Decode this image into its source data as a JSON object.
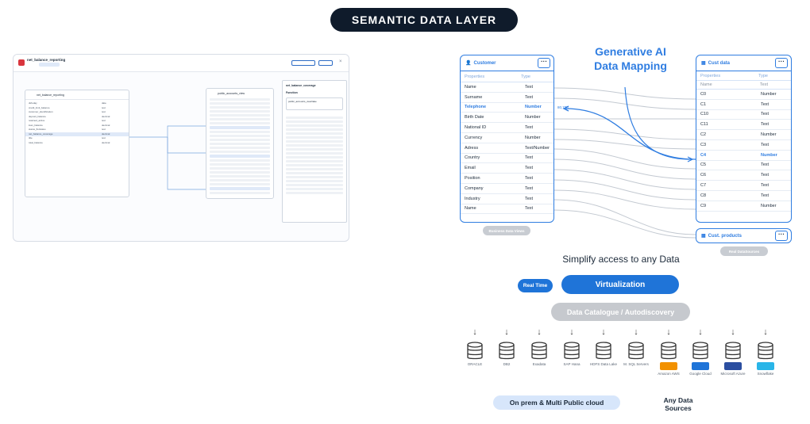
{
  "title": "SEMANTIC DATA LAYER",
  "left_app": {
    "title": "net_balance_reporting",
    "subtitle_a": "",
    "subtitle_b": "",
    "btn_a": "",
    "btn_b": "",
    "card_title": "net_balance_reporting",
    "rows": [
      {
        "k": "dt/today",
        "v": "date"
      },
      {
        "k": "credit_limit_balance",
        "v": "text"
      },
      {
        "k": "customer_identification",
        "v": "text"
      },
      {
        "k": "deposit_balance",
        "v": "decimal"
      },
      {
        "k": "retained_active",
        "v": "text"
      },
      {
        "k": "loan_balance",
        "v": "decimal"
      },
      {
        "k": "status_flo/status",
        "v": "text"
      },
      {
        "k": "net_balance_coverage",
        "v": "decimal"
      },
      {
        "k": "title",
        "v": "text"
      },
      {
        "k": "total_balance",
        "v": "decimal"
      }
    ],
    "mid_card_title": "public_accounts_view",
    "panel_title": "net_balance_coverage",
    "panel_field": "Function",
    "panel_value": "public_accounts_view/take",
    "panel_tabs": [
      "",
      "",
      ""
    ]
  },
  "generative": "Generative AI Data Mapping",
  "customer": {
    "title": "Customer",
    "col_props": "Properties",
    "col_type": "Type",
    "rows": [
      {
        "k": "Name",
        "v": "Text"
      },
      {
        "k": "Surname",
        "v": "Text"
      },
      {
        "k": "Telephone",
        "v": "Number"
      },
      {
        "k": "Birth Date",
        "v": "Number"
      },
      {
        "k": "National ID",
        "v": "Text"
      },
      {
        "k": "Currency",
        "v": "Number"
      },
      {
        "k": "Adress",
        "v": "Text/Number"
      },
      {
        "k": "Country",
        "v": "Text"
      },
      {
        "k": "Email",
        "v": "Text"
      },
      {
        "k": "Position",
        "v": "Text"
      },
      {
        "k": "Company",
        "v": "Text"
      },
      {
        "k": "Industry",
        "v": "Text"
      },
      {
        "k": "Name",
        "v": "Text"
      }
    ],
    "tag": "Business Data Views",
    "arrow_label": "80,773"
  },
  "cust_data": {
    "title": "Cust data",
    "col_props": "Properties",
    "col_type": "Type",
    "sub_name": "Name",
    "sub_text": "Text",
    "rows": [
      {
        "k": "C0",
        "v": "Number"
      },
      {
        "k": "C1",
        "v": "Text"
      },
      {
        "k": "C10",
        "v": "Text"
      },
      {
        "k": "C11",
        "v": "Text"
      },
      {
        "k": "C2",
        "v": "Number"
      },
      {
        "k": "C3",
        "v": "Text"
      },
      {
        "k": "C4",
        "v": "Number"
      },
      {
        "k": "C5",
        "v": "Text"
      },
      {
        "k": "C6",
        "v": "Text"
      },
      {
        "k": "C7",
        "v": "Text"
      },
      {
        "k": "C8",
        "v": "Text"
      },
      {
        "k": "C9",
        "v": "Number"
      }
    ]
  },
  "cust_products": {
    "title": "Cust. products",
    "tag": "Real DataSources"
  },
  "simplify": "Simplify access to any Data",
  "real_time": "Real Time",
  "virtualization": "Virtualization",
  "catalogue": "Data Catalogue / Autodiscovery",
  "sources": [
    {
      "label": "ORACLE",
      "icon": "database-icon"
    },
    {
      "label": "DB2",
      "icon": "database-icon"
    },
    {
      "label": "Exadata",
      "icon": "database-icon"
    },
    {
      "label": "SAP Hana",
      "icon": "database-icon"
    },
    {
      "label": "HDFS Data Lake",
      "icon": "database-icon"
    },
    {
      "label": "M. SQL Servers",
      "icon": "database-icon"
    },
    {
      "label": "Amazon AWS",
      "icon": "database-icon",
      "brand": "aws",
      "color": "#f29100"
    },
    {
      "label": "Google Cloud",
      "icon": "database-icon",
      "brand": "gcp",
      "color": "#1f74d8"
    },
    {
      "label": "Microsoft Azure",
      "icon": "database-icon",
      "brand": "azure",
      "color": "#2b4ea0"
    },
    {
      "label": "Snowflake",
      "icon": "database-icon",
      "brand": "snowflake",
      "color": "#29b5e8"
    }
  ],
  "on_prem": "On prem & Multi Public cloud",
  "any_data": "Any Data Sources",
  "colors": {
    "accent": "#2f7de1",
    "dark": "#0f1b2b",
    "grey": "#c6c9ce"
  }
}
